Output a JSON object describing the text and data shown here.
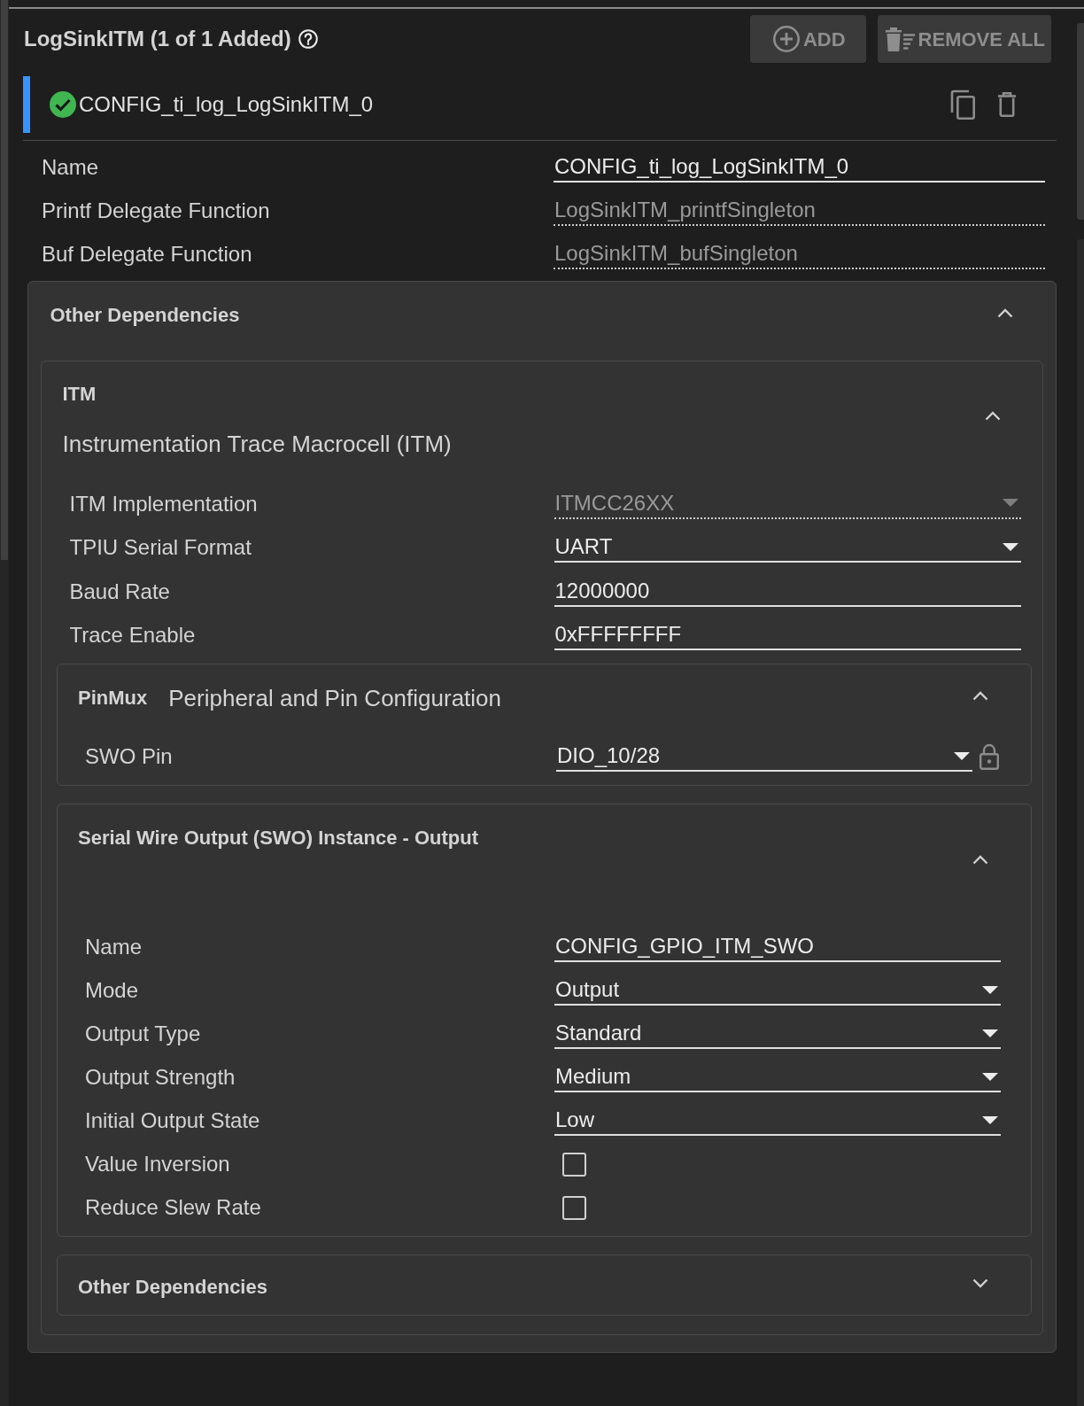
{
  "header": {
    "title": "LogSinkITM (1 of 1 Added)",
    "buttons": [
      {
        "kind": "add",
        "label": "ADD",
        "disabled": true
      },
      {
        "kind": "remove_all",
        "label": "REMOVE ALL",
        "disabled": true
      }
    ]
  },
  "instances": [
    {
      "name": "CONFIG_ti_log_LogSinkITM_0",
      "selected": true,
      "valid": true
    }
  ],
  "fields": [
    {
      "label": "Name",
      "kind": "text",
      "value": "CONFIG_ti_log_LogSinkITM_0",
      "readonly": false
    },
    {
      "label": "Printf Delegate Function",
      "kind": "text",
      "value": "LogSinkITM_printfSingleton",
      "readonly": true
    },
    {
      "label": "Buf Delegate Function",
      "kind": "text",
      "value": "LogSinkITM_bufSingleton",
      "readonly": true
    }
  ],
  "dependencies": {
    "title": "Other Dependencies",
    "expanded": true,
    "modules": [
      {
        "title": "ITM",
        "subtitle": "Instrumentation Trace Macrocell (ITM)",
        "expanded": true,
        "fields": [
          {
            "label": "ITM Implementation",
            "kind": "select",
            "value": "ITMCC26XX",
            "readonly": true
          },
          {
            "label": "TPIU Serial Format",
            "kind": "select",
            "value": "UART",
            "readonly": false
          },
          {
            "label": "Baud Rate",
            "kind": "text",
            "value": "12000000",
            "readonly": false
          },
          {
            "label": "Trace Enable",
            "kind": "text",
            "value": "0xFFFFFFFF",
            "readonly": false
          }
        ],
        "groups": [
          {
            "kind": "pinmux",
            "title": "PinMux",
            "subtitle": "Peripheral and Pin Configuration",
            "expanded": true,
            "fields": [
              {
                "label": "SWO Pin",
                "kind": "select",
                "value": "DIO_10/28",
                "readonly": false,
                "locked": true
              }
            ]
          },
          {
            "kind": "instance",
            "title": "Serial Wire Output (SWO) Instance - Output",
            "expanded": true,
            "fields": [
              {
                "label": "Name",
                "kind": "text",
                "value": "CONFIG_GPIO_ITM_SWO",
                "readonly": false
              },
              {
                "label": "Mode",
                "kind": "select",
                "value": "Output",
                "readonly": false
              },
              {
                "label": "Output Type",
                "kind": "select",
                "value": "Standard",
                "readonly": false
              },
              {
                "label": "Output Strength",
                "kind": "select",
                "value": "Medium",
                "readonly": false
              },
              {
                "label": "Initial Output State",
                "kind": "select",
                "value": "Low",
                "readonly": false
              },
              {
                "label": "Value Inversion",
                "kind": "checkbox",
                "checked": false
              },
              {
                "label": "Reduce Slew Rate",
                "kind": "checkbox",
                "checked": false
              }
            ]
          },
          {
            "kind": "dependencies",
            "title": "Other Dependencies",
            "expanded": false
          }
        ]
      }
    ]
  }
}
